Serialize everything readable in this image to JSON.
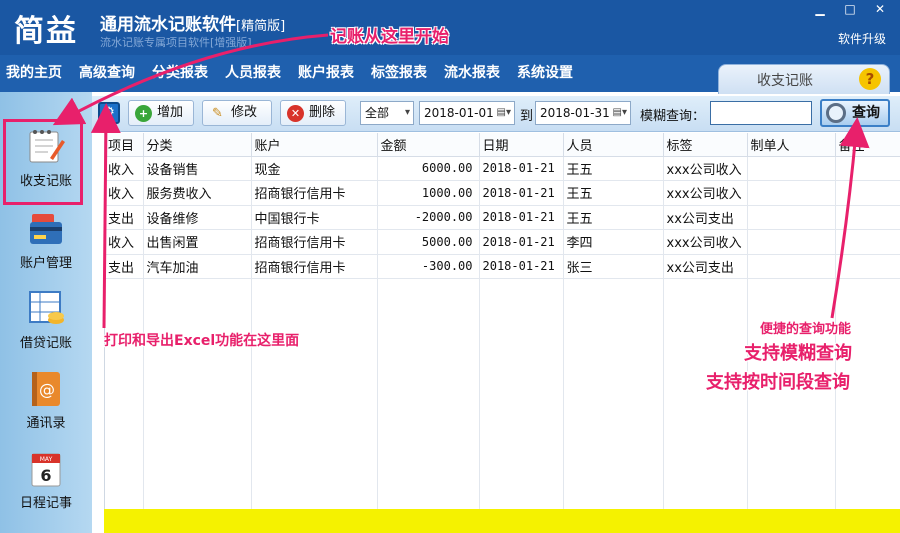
{
  "app": {
    "logo": "简益",
    "title": "通用流水记账软件",
    "edition": "[精简版]",
    "subtitle": "流水记账专属项目软件[增强版]",
    "upgrade": "软件升级",
    "controls": [
      "▁",
      "□",
      "✕"
    ]
  },
  "menu": {
    "items": [
      "我的主页",
      "高级查询",
      "分类报表",
      "人员报表",
      "账户报表",
      "标签报表",
      "流水报表",
      "系统设置"
    ]
  },
  "active_tab": {
    "label": "收支记账",
    "help": "?"
  },
  "sidebar": {
    "items": [
      {
        "label": "收支记账",
        "icon": "notebook-pen-icon"
      },
      {
        "label": "账户管理",
        "icon": "bank-card-icon"
      },
      {
        "label": "借贷记账",
        "icon": "ledger-coins-icon"
      },
      {
        "label": "通讯录",
        "icon": "address-book-icon"
      },
      {
        "label": "日程记事",
        "icon": "calendar-icon",
        "calendar_month": "MAY",
        "calendar_day": "6"
      }
    ]
  },
  "toolbar": {
    "add": "增加",
    "edit": "修改",
    "delete": "删除",
    "filter_select": "全部",
    "date_from": "2018-01-01",
    "date_to_label": "到",
    "date_to": "2018-01-31",
    "fuzzy_label": "模糊查询：",
    "search_value": "",
    "search_button": "查询"
  },
  "table": {
    "columns": [
      "项目",
      "分类",
      "账户",
      "金额",
      "日期",
      "人员",
      "标签",
      "制单人",
      "备注"
    ],
    "rows": [
      [
        "收入",
        "设备销售",
        "现金",
        "6000.00",
        "2018-01-21",
        "王五",
        "xxx公司收入",
        "",
        ""
      ],
      [
        "收入",
        "服务费收入",
        "招商银行信用卡",
        "1000.00",
        "2018-01-21",
        "王五",
        "xxx公司收入",
        "",
        ""
      ],
      [
        "支出",
        "设备维修",
        "中国银行卡",
        "-2000.00",
        "2018-01-21",
        "王五",
        "xx公司支出",
        "",
        ""
      ],
      [
        "收入",
        "出售闲置",
        "招商银行信用卡",
        "5000.00",
        "2018-01-21",
        "李四",
        "xxx公司收入",
        "",
        ""
      ],
      [
        "支出",
        "汽车加油",
        "招商银行信用卡",
        "-300.00",
        "2018-01-21",
        "张三",
        "xx公司支出",
        "",
        ""
      ]
    ]
  },
  "annotations": {
    "start_here": "记账从这里开始",
    "print_export": "打印和导出Excel功能在这里面",
    "query_title": "便捷的查询功能",
    "query_fuzzy": "支持模糊查询",
    "query_period": "支持按时间段查询"
  },
  "colors": {
    "title_bar": "#1a57a3",
    "menu_bar": "#1f60ae",
    "annotation": "#e8206b",
    "total_bar": "#f5f200",
    "sidebar": "#a7cfee"
  }
}
